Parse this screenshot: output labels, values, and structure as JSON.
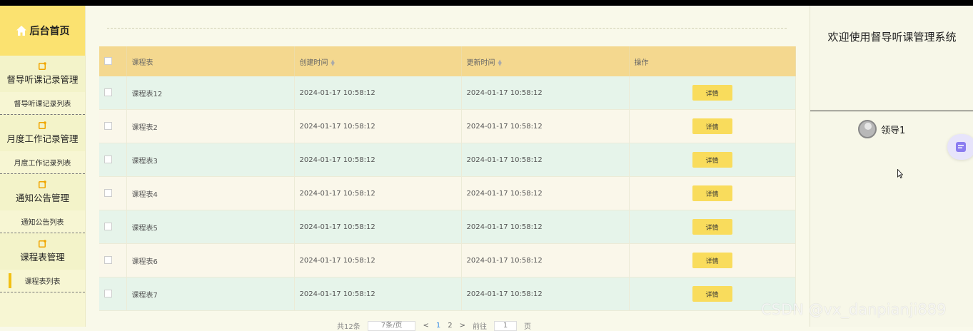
{
  "sidebar": {
    "home_label": "后台首页",
    "groups": [
      {
        "title": "督导听课记录管理",
        "item": "督导听课记录列表"
      },
      {
        "title": "月度工作记录管理",
        "item": "月度工作记录列表"
      },
      {
        "title": "通知公告管理",
        "item": "通知公告列表"
      },
      {
        "title": "课程表管理",
        "item": "课程表列表"
      }
    ],
    "active_item": "课程表列表"
  },
  "table": {
    "headers": [
      "课程表",
      "创建时间",
      "更新时间",
      "操作"
    ],
    "rows": [
      {
        "name": "课程表12",
        "created": "2024-01-17 10:58:12",
        "updated": "2024-01-17 10:58:12",
        "action": "详情"
      },
      {
        "name": "课程表2",
        "created": "2024-01-17 10:58:12",
        "updated": "2024-01-17 10:58:12",
        "action": "详情"
      },
      {
        "name": "课程表3",
        "created": "2024-01-17 10:58:12",
        "updated": "2024-01-17 10:58:12",
        "action": "详情"
      },
      {
        "name": "课程表4",
        "created": "2024-01-17 10:58:12",
        "updated": "2024-01-17 10:58:12",
        "action": "详情"
      },
      {
        "name": "课程表5",
        "created": "2024-01-17 10:58:12",
        "updated": "2024-01-17 10:58:12",
        "action": "详情"
      },
      {
        "name": "课程表6",
        "created": "2024-01-17 10:58:12",
        "updated": "2024-01-17 10:58:12",
        "action": "详情"
      },
      {
        "name": "课程表7",
        "created": "2024-01-17 10:58:12",
        "updated": "2024-01-17 10:58:12",
        "action": "详情"
      }
    ]
  },
  "pager": {
    "total_text": "共12条",
    "page_size": "7条/页",
    "prev": "<",
    "page1": "1",
    "page2": "2",
    "next": ">",
    "goto_prefix": "前往",
    "goto_value": "1",
    "goto_suffix": "页"
  },
  "right_panel": {
    "welcome": "欢迎使用督导听课管理系统",
    "user_name": "领导1"
  },
  "watermark": "CSDN @vx_danpianji889",
  "icons": {
    "home": "home-icon",
    "group": "folder-icon",
    "sort": "sort-icon",
    "avatar": "avatar-icon",
    "float": "chat-icon",
    "cursor": "cursor-icon"
  },
  "colors": {
    "sidebar_header": "#fbe270",
    "table_header": "#f4d88f",
    "button": "#f9dc5c",
    "active_marker": "#f2c014",
    "row_alt_a": "#e6f4ea",
    "row_alt_b": "#faf7ea"
  }
}
